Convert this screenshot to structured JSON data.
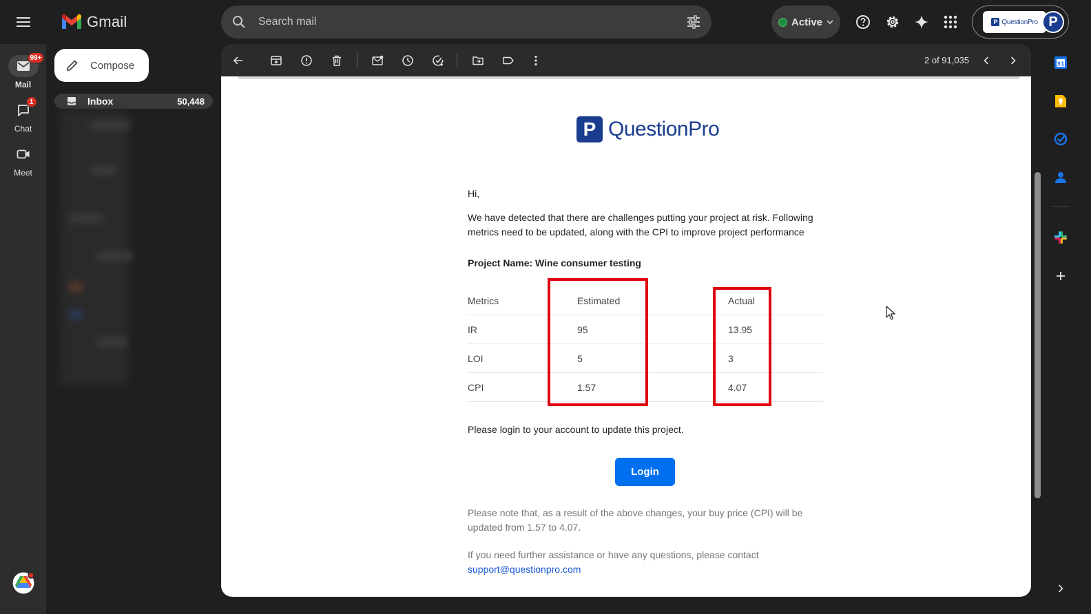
{
  "app": {
    "name": "Gmail"
  },
  "search": {
    "placeholder": "Search mail"
  },
  "status": {
    "label": "Active",
    "color": "#1e8e3e"
  },
  "account": {
    "org_name": "QuestionPro",
    "avatar_letter": "P"
  },
  "rail": {
    "mail": {
      "label": "Mail",
      "badge": "99+"
    },
    "chat": {
      "label": "Chat",
      "badge": "1"
    },
    "meet": {
      "label": "Meet"
    }
  },
  "nav": {
    "compose_label": "Compose",
    "inbox": {
      "label": "Inbox",
      "count": "50,448"
    }
  },
  "toolbar": {
    "pager": "2 of 91,035"
  },
  "email": {
    "brand": {
      "letter": "P",
      "name": "QuestionPro",
      "color": "#1a3d8f"
    },
    "greeting": "Hi,",
    "intro_line1": "We have detected that there are challenges putting your project at risk. Following",
    "intro_line2": "metrics need to be updated, along with the CPI to improve project performance",
    "project_line": "Project Name: Wine consumer testing",
    "table": {
      "headers": [
        "Metrics",
        "Estimated",
        "Actual"
      ],
      "rows": [
        {
          "metric": "IR",
          "estimated": "95",
          "actual": "13.95"
        },
        {
          "metric": "LOI",
          "estimated": "5",
          "actual": "3"
        },
        {
          "metric": "CPI",
          "estimated": "1.57",
          "actual": "4.07"
        }
      ]
    },
    "login_prompt": "Please login to your account to update this project.",
    "login_button": "Login",
    "note_line1": "Please note that, as a result of the above changes, your buy price (CPI) will be",
    "note_line2": "updated from 1.57 to 4.07.",
    "help_line": "If you need further assistance or have any questions, please contact",
    "support_email": "support@questionpro.com",
    "highlight_color": "#e0000f"
  },
  "side_panel": {
    "apps": [
      "calendar-icon",
      "keep-icon",
      "tasks-icon",
      "contacts-icon",
      "slack-icon",
      "add-icon",
      "expand-icon"
    ]
  }
}
